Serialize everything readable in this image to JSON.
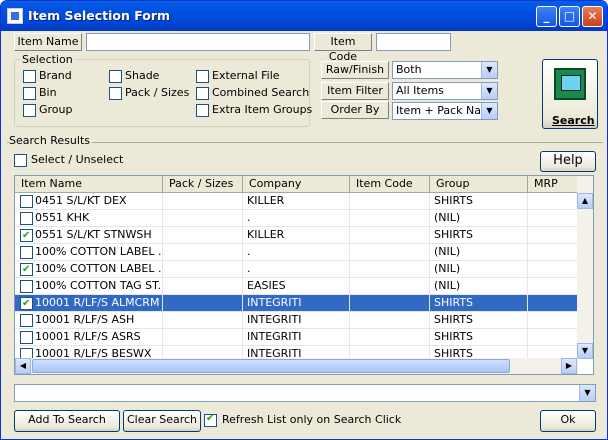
{
  "window": {
    "title": "Item Selection Form",
    "min": "_",
    "max": "□",
    "close": "✕"
  },
  "top": {
    "item_name_label": "Item Name",
    "item_name_value": "",
    "item_code_label": "Item Code",
    "item_code_value": ""
  },
  "selection": {
    "title": "Selection",
    "options": [
      {
        "label": "Brand",
        "checked": false
      },
      {
        "label": "Bin",
        "checked": false
      },
      {
        "label": "Group",
        "checked": false
      },
      {
        "label": "Shade",
        "checked": false
      },
      {
        "label": "Pack / Sizes",
        "checked": false
      },
      {
        "label": "External File",
        "checked": false
      },
      {
        "label": "Combined Search",
        "checked": false
      },
      {
        "label": "Extra Item Groups",
        "checked": false
      }
    ]
  },
  "filters": {
    "raw_finish_label": "Raw/Finish",
    "raw_finish_value": "Both",
    "item_filter_label": "Item Filter",
    "item_filter_value": "All Items",
    "order_by_label": "Order By",
    "order_by_value": "Item + Pack  Nam"
  },
  "search": {
    "label": "Search",
    "icon": "search-computer-icon"
  },
  "results": {
    "title": "Search Results",
    "select_label": "Select / Unselect",
    "help_label": "Help",
    "columns": [
      "Item Name",
      "Pack / Sizes",
      "Company",
      "Item Code",
      "Group",
      "MRP"
    ],
    "rows": [
      {
        "checked": false,
        "name": "0451 S/L/KT DEX",
        "pack": "",
        "company": "KILLER",
        "code": "",
        "group": "SHIRTS",
        "mrp": "",
        "selected": false
      },
      {
        "checked": false,
        "name": "0551 KHK",
        "pack": "",
        "company": ".",
        "code": "",
        "group": "(NIL)",
        "mrp": "",
        "selected": false
      },
      {
        "checked": true,
        "name": "0551 S/L/KT STNWSH",
        "pack": "",
        "company": "KILLER",
        "code": "",
        "group": "SHIRTS",
        "mrp": "",
        "selected": false
      },
      {
        "checked": false,
        "name": "100% COTTON LABEL ...",
        "pack": "",
        "company": ".",
        "code": "",
        "group": "(NIL)",
        "mrp": "",
        "selected": false
      },
      {
        "checked": true,
        "name": "100% COTTON LABEL ...",
        "pack": "",
        "company": ".",
        "code": "",
        "group": "(NIL)",
        "mrp": "",
        "selected": false
      },
      {
        "checked": false,
        "name": "100% COTTON TAG ST...",
        "pack": "",
        "company": "EASIES",
        "code": "",
        "group": "(NIL)",
        "mrp": "",
        "selected": false
      },
      {
        "checked": true,
        "name": "10001 R/LF/S ALMCRM",
        "pack": "",
        "company": "INTEGRITI",
        "code": "",
        "group": "SHIRTS",
        "mrp": "",
        "selected": true
      },
      {
        "checked": false,
        "name": "10001 R/LF/S ASH",
        "pack": "",
        "company": "INTEGRITI",
        "code": "",
        "group": "SHIRTS",
        "mrp": "",
        "selected": false
      },
      {
        "checked": false,
        "name": "10001 R/LF/S ASRS",
        "pack": "",
        "company": "INTEGRITI",
        "code": "",
        "group": "SHIRTS",
        "mrp": "",
        "selected": false
      },
      {
        "checked": false,
        "name": "10001 R/LF/S BESWX",
        "pack": "",
        "company": "INTEGRITI",
        "code": "",
        "group": "SHIRTS",
        "mrp": "",
        "selected": false
      }
    ]
  },
  "bottom": {
    "combo_value": "",
    "add_label": "Add To Search",
    "clear_label": "Clear Search",
    "refresh_label": "Refresh List only on Search Click",
    "refresh_checked": true,
    "ok_label": "Ok"
  }
}
